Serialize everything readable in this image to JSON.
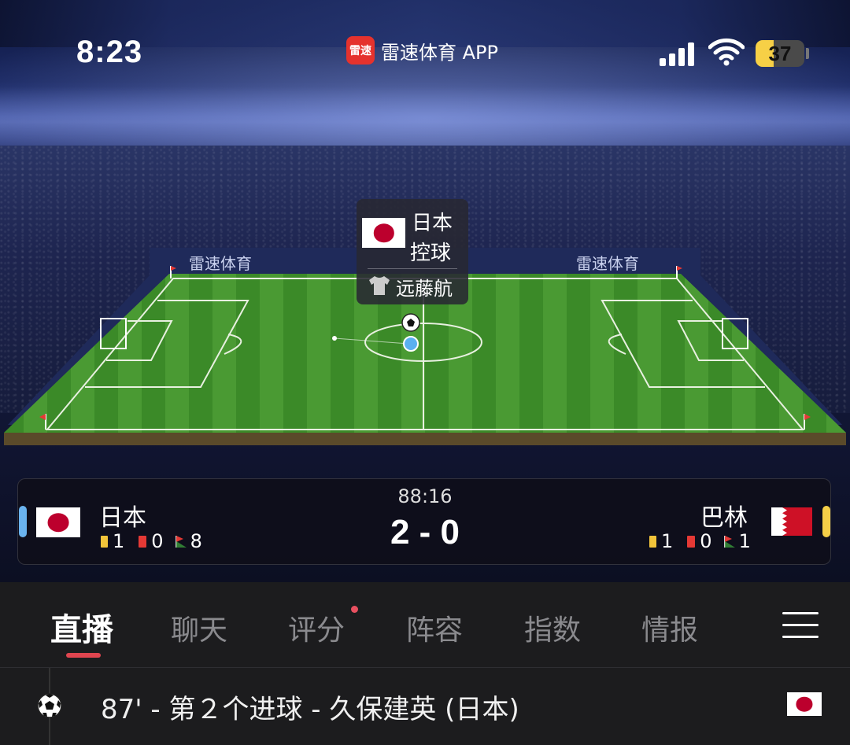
{
  "status_bar": {
    "time": "8:23",
    "app_badge_icon_text": "雷速",
    "app_name": "雷速体育 APP",
    "battery_percent": 37
  },
  "pitch": {
    "sponsor_text": "雷速体育",
    "possession_popup": {
      "team": "日本",
      "state": "控球",
      "player": "远藤航",
      "flag_icon": "japan-flag-icon",
      "jersey_icon": "jersey-icon"
    }
  },
  "scoreboard": {
    "clock": "88:16",
    "score": "2 - 0",
    "home": {
      "name": "日本",
      "yellow_cards": "1",
      "red_cards": "0",
      "corners": "8",
      "color": "#6ab3ef"
    },
    "away": {
      "name": "巴林",
      "yellow_cards": "1",
      "red_cards": "0",
      "corners": "1",
      "color": "#f5cf47"
    }
  },
  "tabs": [
    {
      "label": "直播",
      "active": true
    },
    {
      "label": "聊天",
      "active": false
    },
    {
      "label": "评分",
      "active": false,
      "badge": true
    },
    {
      "label": "阵容",
      "active": false
    },
    {
      "label": "指数",
      "active": false
    },
    {
      "label": "情报",
      "active": false
    }
  ],
  "feed": {
    "events": [
      {
        "text": "87' - 第２个进球 - 久保建英 (日本)",
        "icon": "soccer-ball-icon",
        "flag": "japan-flag-icon"
      }
    ]
  },
  "colors": {
    "accent": "#e0454f",
    "pitch_green": "#3f8f2c"
  }
}
